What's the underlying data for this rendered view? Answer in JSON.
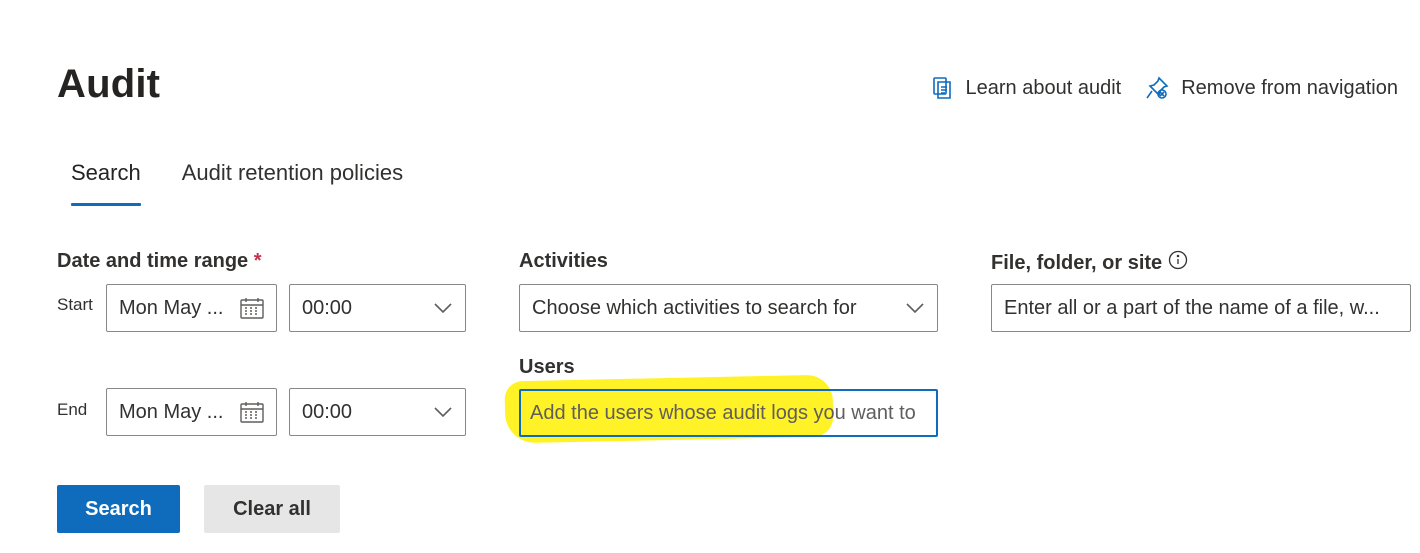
{
  "page": {
    "title": "Audit"
  },
  "header_actions": {
    "learn_label": "Learn about audit",
    "remove_label": "Remove from navigation"
  },
  "tabs": [
    {
      "label": "Search",
      "selected": true
    },
    {
      "label": "Audit retention policies",
      "selected": false
    }
  ],
  "date_range": {
    "label": "Date and time range",
    "required_mark": "*",
    "start": {
      "label": "Start",
      "date": "Mon May ...",
      "time": "00:00"
    },
    "end": {
      "label": "End",
      "date": "Mon May ...",
      "time": "00:00"
    }
  },
  "activities": {
    "label": "Activities",
    "placeholder": "Choose which activities to search for"
  },
  "file_site": {
    "label": "File, folder, or site",
    "placeholder": "Enter all or a part of the name of a file, w..."
  },
  "users": {
    "label": "Users",
    "placeholder": "Add the users whose audit logs you want to"
  },
  "buttons": {
    "search_label": "Search",
    "clear_label": "Clear all"
  },
  "colors": {
    "accent": "#0f6cbd",
    "highlight": "#fff000",
    "required": "#c4314b"
  }
}
